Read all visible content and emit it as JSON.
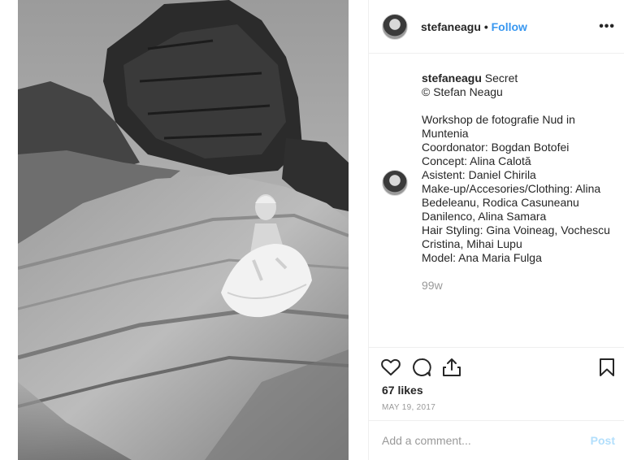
{
  "post": {
    "username": "stefaneagu",
    "separator": "•",
    "follow_label": "Follow",
    "more_label": "•••"
  },
  "caption": {
    "username": "stefaneagu",
    "text": " Secret\n© Stefan Neagu\n\nWorkshop de fotografie Nud in Muntenia\nCoordonator: Bogdan Botofei\nConcept: Alina Calotă\nAsistent: Daniel Chirila\nMake-up/Accesories/Clothing: Alina Bedeleanu, Rodica Casuneanu Danilenco, Alina Samara\nHair Styling: Gina Voineag, Vochescu Cristina, Mihai Lupu\nModel: Ana Maria Fulga",
    "time_ago": "99w"
  },
  "actions": {
    "likes": "67 likes",
    "date": "MAY 19, 2017",
    "icons": [
      "heart-icon",
      "comment-icon",
      "share-icon",
      "bookmark-icon"
    ]
  },
  "comment": {
    "placeholder": "Add a comment...",
    "post_label": "Post"
  },
  "colors": {
    "link_blue": "#3897f0",
    "post_disabled": "#b2dffc",
    "muted": "#999999",
    "divider": "#efefef"
  }
}
